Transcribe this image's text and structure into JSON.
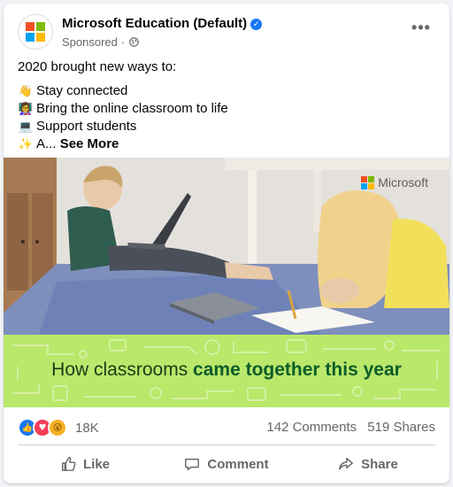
{
  "post": {
    "page_name": "Microsoft Education (Default)",
    "sponsored": "Sponsored",
    "meta_separator": "·",
    "more_label": "•••",
    "intro": "2020 brought new ways to:",
    "lines": [
      {
        "emoji": "👋",
        "text": "Stay connected"
      },
      {
        "emoji": "👩‍🏫",
        "text": "Bring the online classroom to life"
      },
      {
        "emoji": "💻",
        "text": "Support students"
      },
      {
        "emoji": "✨",
        "text": "A..."
      }
    ],
    "see_more": "See More"
  },
  "image": {
    "brand": "Microsoft",
    "banner_plain": "How classrooms ",
    "banner_bold": "came together this year"
  },
  "stats": {
    "reaction_count": "18K",
    "comments": "142 Comments",
    "shares": "519 Shares"
  },
  "actions": {
    "like": "Like",
    "comment": "Comment",
    "share": "Share"
  },
  "colors": {
    "ms_red": "#f25022",
    "ms_green": "#7fba00",
    "ms_blue": "#00a4ef",
    "ms_yellow": "#ffb900",
    "banner": "#b9e86b",
    "verified": "#1877f2"
  }
}
